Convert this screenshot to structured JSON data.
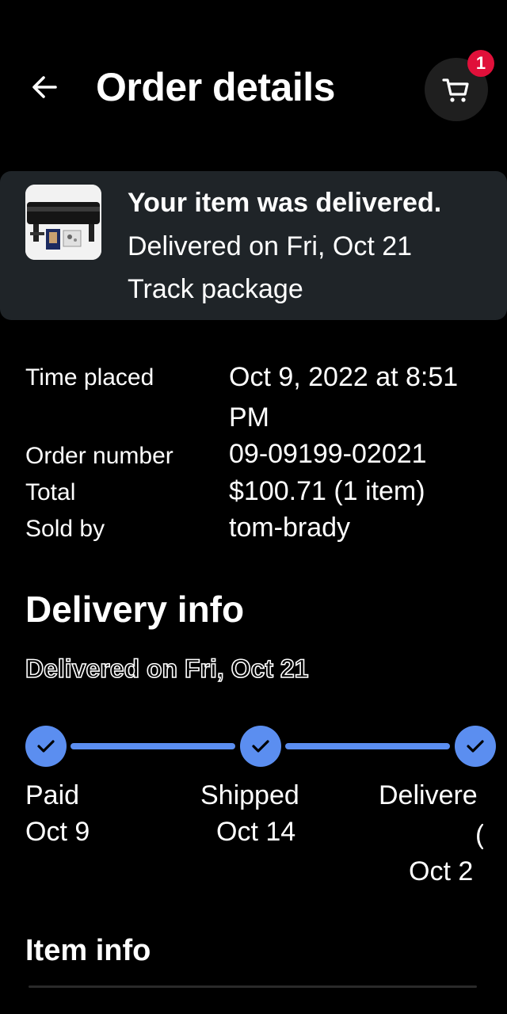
{
  "header": {
    "title": "Order details",
    "back_icon": "arrow-left-icon",
    "cart_icon": "cart-icon",
    "cart_count": "1"
  },
  "status_card": {
    "title": "Your item was delivered.",
    "subtitle": "Delivered on Fri, Oct 21",
    "track_link": "Track package"
  },
  "order": {
    "time_placed_label": "Time placed",
    "time_placed_value_line1": "Oct 9, 2022 at 8:51",
    "time_placed_value_line2": "PM",
    "order_number_label": "Order number",
    "order_number_value": "09-09199-02021",
    "total_label": "Total",
    "total_value": "$100.71 (1 item)",
    "sold_by_label": "Sold by",
    "sold_by_value": "tom-brady"
  },
  "delivery_info": {
    "title": "Delivery info",
    "status": "Delivered on Fri, Oct 21",
    "steps": [
      {
        "label": "Paid",
        "date": "Oct 9"
      },
      {
        "label": "Shipped",
        "date": "Oct 14"
      },
      {
        "label": "Delivere",
        "extra": "(",
        "date": "Oct 2"
      }
    ]
  },
  "item_info": {
    "title": "Item info"
  },
  "colors": {
    "background": "#000000",
    "card": "#1f2428",
    "accent": "#5b8ef0",
    "badge": "#e0103a"
  }
}
